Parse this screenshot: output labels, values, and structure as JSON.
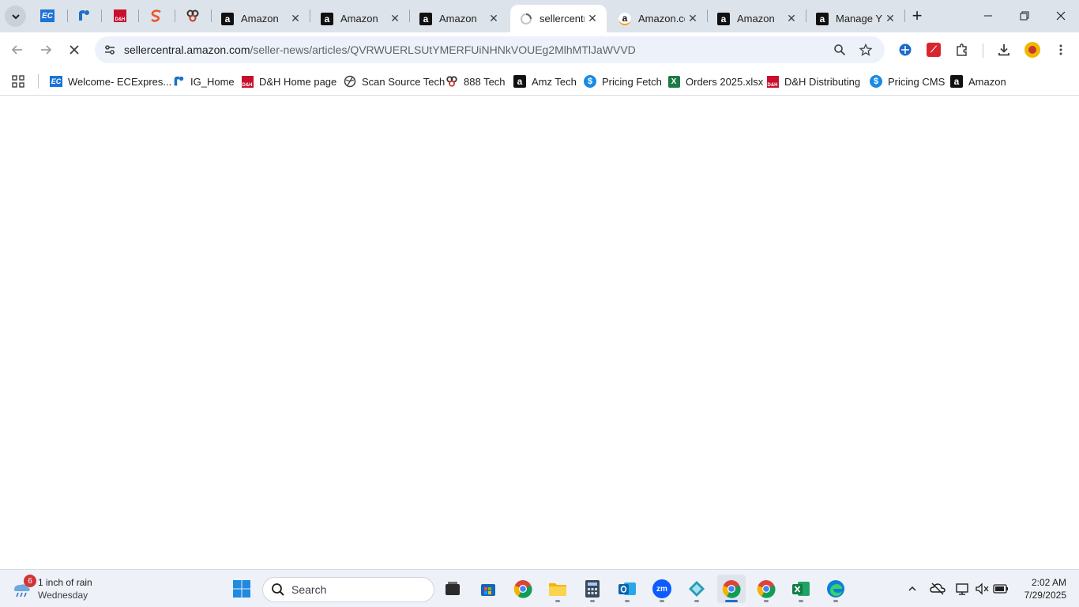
{
  "browser": {
    "tabs": [
      {
        "label": "Amazon",
        "icon": "amazon-icon"
      },
      {
        "label": "Amazon",
        "icon": "amazon-icon"
      },
      {
        "label": "Amazon",
        "icon": "amazon-icon"
      },
      {
        "label": "sellercentr",
        "icon": "loading-icon",
        "active": true
      },
      {
        "label": "Amazon.co",
        "icon": "amazon-smile-icon"
      },
      {
        "label": "Amazon",
        "icon": "amazon-icon"
      },
      {
        "label": "Manage Y",
        "icon": "amazon-icon"
      }
    ],
    "pinned_tabs": [
      "ecexpress-icon",
      "ig-icon",
      "dh-icon",
      "scansource-icon",
      "888-icon"
    ],
    "address": {
      "host": "sellercentral.amazon.com",
      "path": "/seller-news/articles/QVRWUERLSUtYMERFUiNHNkVOUEg2MlhMTlJaWVVD"
    },
    "bookmarks": [
      {
        "label": "Welcome- ECExpres...",
        "icon": "ecexpress-icon"
      },
      {
        "label": "IG_Home",
        "icon": "ig-icon"
      },
      {
        "label": "D&H Home page",
        "icon": "dh-icon"
      },
      {
        "label": "Scan Source Tech",
        "icon": "globe-icon"
      },
      {
        "label": "888 Tech",
        "icon": "888-icon"
      },
      {
        "label": "Amz Tech",
        "icon": "amazon-icon"
      },
      {
        "label": "Pricing Fetch",
        "icon": "pricing-icon"
      },
      {
        "label": "Orders 2025.xlsx",
        "icon": "excel-icon"
      },
      {
        "label": "D&H Distributing",
        "icon": "dh-icon"
      },
      {
        "label": "Pricing CMS",
        "icon": "pricing-icon"
      },
      {
        "label": "Amazon",
        "icon": "amazon-icon"
      }
    ]
  },
  "taskbar": {
    "weather": {
      "badge": "6",
      "line1": "1 inch of rain",
      "line2": "Wednesday"
    },
    "search_label": "Search",
    "clock": {
      "time": "2:02 AM",
      "date": "7/29/2025"
    }
  },
  "colors": {
    "accent": "#1a73e8",
    "tabstrip": "#dde3ea",
    "omnibox": "#edf2fa"
  }
}
